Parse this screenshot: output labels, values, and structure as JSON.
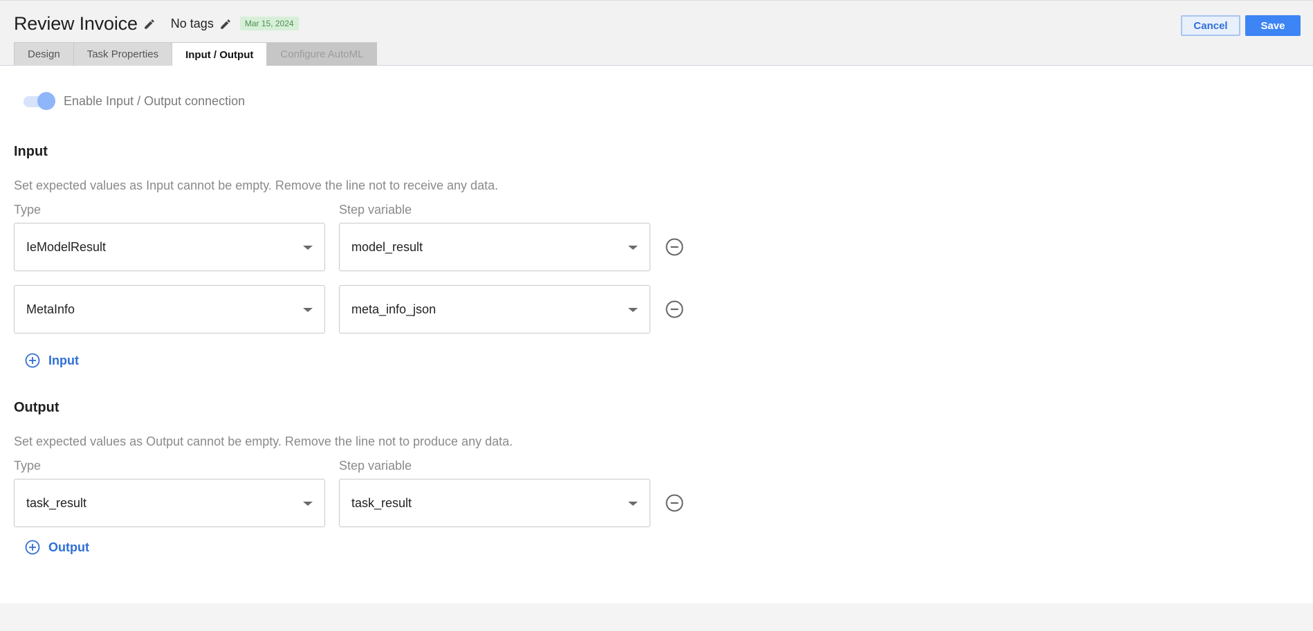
{
  "header": {
    "title": "Review Invoice",
    "tags": "No tags",
    "date": "Mar 15, 2024",
    "cancel_label": "Cancel",
    "save_label": "Save"
  },
  "tabs": [
    {
      "label": "Design",
      "state": "normal"
    },
    {
      "label": "Task Properties",
      "state": "normal"
    },
    {
      "label": "Input / Output",
      "state": "active"
    },
    {
      "label": "Configure AutoML",
      "state": "disabled"
    }
  ],
  "io": {
    "toggle_label": "Enable Input / Output connection",
    "toggle_on": true,
    "input": {
      "title": "Input",
      "description": "Set expected values as Input cannot be empty. Remove the line not to receive any data.",
      "type_label": "Type",
      "variable_label": "Step variable",
      "rows": [
        {
          "type": "IeModelResult",
          "variable": "model_result"
        },
        {
          "type": "MetaInfo",
          "variable": "meta_info_json"
        }
      ],
      "add_label": "Input"
    },
    "output": {
      "title": "Output",
      "description": "Set expected values as Output cannot be empty. Remove the line not to produce any data.",
      "type_label": "Type",
      "variable_label": "Step variable",
      "rows": [
        {
          "type": "task_result",
          "variable": "task_result"
        }
      ],
      "add_label": "Output"
    }
  },
  "colors": {
    "accent": "#3d84f5",
    "link": "#2f6fd6",
    "date_badge_bg": "#d7efd8",
    "date_badge_text": "#4f8f52"
  }
}
